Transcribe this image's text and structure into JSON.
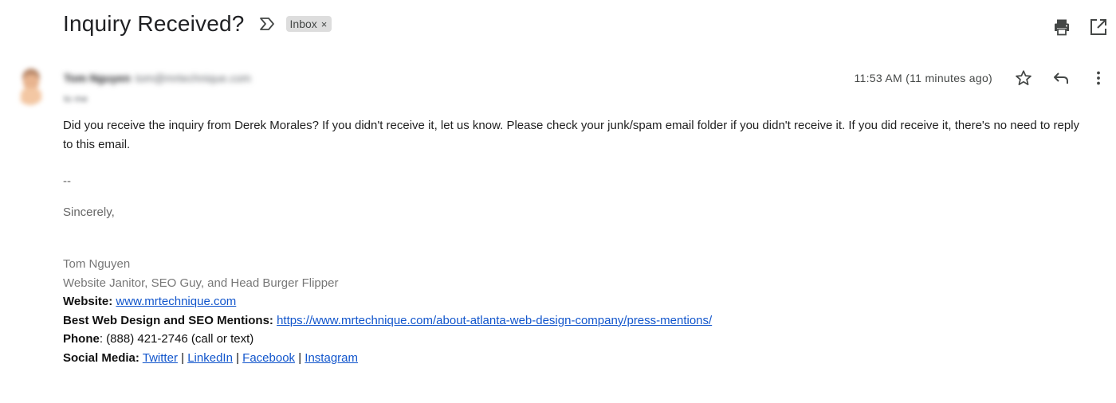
{
  "email": {
    "subject": "Inquiry Received?",
    "label": "Inbox",
    "label_remove": "×",
    "sender_name": "Tom Nguyen",
    "sender_email": "tom@mrtechnique.com",
    "recipient": "to me",
    "timestamp": "11:53 AM (11 minutes ago)",
    "body": "Did you receive the inquiry from Derek Morales? If you didn't receive it, let us know.  Please check your junk/spam email folder if you didn't receive it. If you did receive it, there's no need to reply to this email.",
    "signature": {
      "separator": "--",
      "closing": "Sincerely,",
      "name": "Tom Nguyen",
      "title": "Website Janitor, SEO Guy, and Head Burger Flipper",
      "website_label": "Website:",
      "website_link": "www.mrtechnique.com",
      "mentions_label": "Best Web Design and SEO Mentions:",
      "mentions_link": "https://www.mrtechnique.com/about-atlanta-web-design-company/press-mentions/",
      "phone_label": "Phone",
      "phone_value": ": (888) 421-2746 (call or text)",
      "social_label": "Social Media:",
      "social_links": [
        "Twitter",
        "LinkedIn",
        "Facebook",
        "Instagram"
      ],
      "social_separator": "|"
    }
  },
  "icons": {
    "important": "important-marker-icon",
    "print": "print-icon",
    "open_new_window": "open-in-new-window-icon",
    "star": "star-icon",
    "reply": "reply-icon",
    "more": "more-vertical-icon"
  },
  "colors": {
    "link": "#1155cc",
    "chip_bg": "#dddddd",
    "text": "#202124",
    "muted": "#777777"
  }
}
